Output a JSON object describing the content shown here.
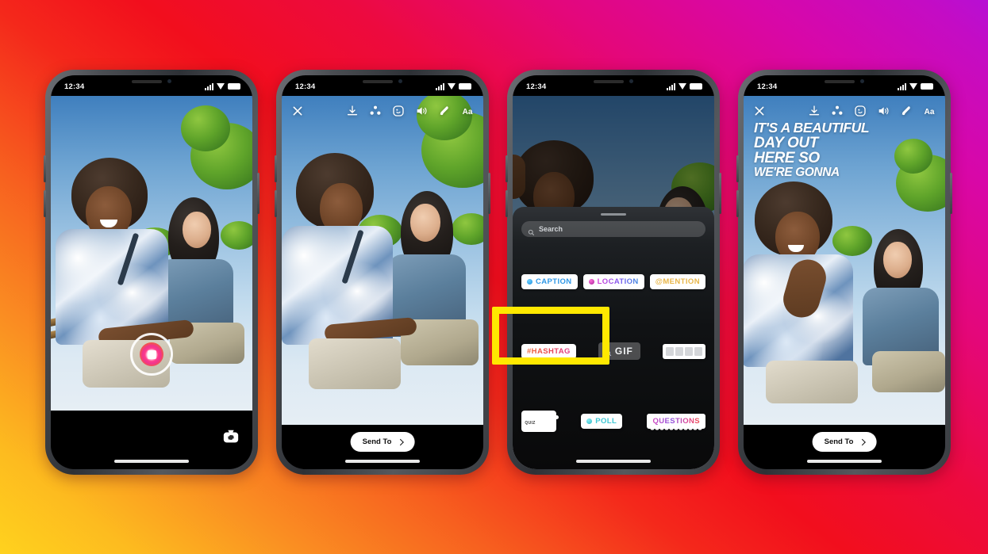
{
  "background": {
    "name": "instagram-gradient",
    "colors": [
      "#FFD21E",
      "#FA8E22",
      "#F20E1D",
      "#E4077A",
      "#C40CC4",
      "#B70FD4"
    ]
  },
  "highlight": {
    "color": "#FFE800",
    "target": "caption-sticker"
  },
  "status_bar": {
    "time": "12:34",
    "signal_icon": "cellular-signal-icon",
    "wifi_icon": "wifi-icon",
    "battery_icon": "battery-icon"
  },
  "toolbar": {
    "close_icon": "close-x-icon",
    "items": [
      {
        "icon": "download-icon"
      },
      {
        "icon": "effects-sparkle-icon"
      },
      {
        "icon": "sticker-smiley-icon"
      },
      {
        "icon": "audio-volume-icon"
      },
      {
        "icon": "draw-pen-icon"
      },
      {
        "icon": "text-aa-icon",
        "label": "Aa"
      }
    ]
  },
  "phones": [
    {
      "id": "phone-camera",
      "name": "story-camera-screen",
      "shutter_icon": "shutter-button",
      "flip_camera_icon": "flip-camera-icon"
    },
    {
      "id": "phone-editor",
      "name": "story-editor-screen",
      "send_to": {
        "label": "Send To",
        "chevron_icon": "chevron-right-icon"
      }
    },
    {
      "id": "phone-stickers",
      "name": "sticker-tray-screen",
      "search": {
        "placeholder": "Search",
        "icon": "search-icon"
      },
      "grabber": "sheet-drag-handle"
    },
    {
      "id": "phone-caption",
      "name": "story-caption-screen",
      "send_to": {
        "label": "Send To",
        "chevron_icon": "chevron-right-icon"
      }
    }
  ],
  "stickers": {
    "rows": [
      [
        {
          "id": "caption",
          "label": "CAPTION",
          "style": "chip",
          "icon": "blue-dot-icon",
          "color": "#2e97e6",
          "highlighted": true
        },
        {
          "id": "location",
          "label": "LOCATION",
          "style": "chip",
          "icon": "pink-dot-icon",
          "color": "#8a4fd8"
        },
        {
          "id": "mention",
          "label": "@MENTION",
          "style": "chip",
          "color": "#e8b649"
        }
      ],
      [
        {
          "id": "hashtag",
          "label": "#HASHTAG",
          "style": "chip",
          "color": "#e8454f"
        },
        {
          "id": "gif",
          "label": "GIF",
          "style": "gif",
          "icon": "search-icon"
        },
        {
          "id": "countdown",
          "label": "COUNTDOWN",
          "style": "countdown",
          "digits": [
            "",
            "",
            "",
            ""
          ]
        }
      ],
      [
        {
          "id": "quiz",
          "label": "QUIZ",
          "style": "quiz"
        },
        {
          "id": "poll",
          "label": "POLL",
          "style": "chip",
          "icon": "poll-dot-icon",
          "color": "#3fc7d4"
        },
        {
          "id": "questions",
          "label": "QUESTIONS",
          "style": "scallop",
          "color": "#d44bbf"
        }
      ]
    ]
  },
  "caption_overlay": {
    "lines": [
      "IT'S A BEAUTIFUL",
      "DAY OUT",
      "HERE SO",
      "WE'RE GONNA"
    ]
  }
}
